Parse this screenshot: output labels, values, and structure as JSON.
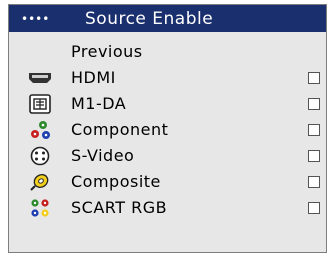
{
  "menu": {
    "title_dots": "••••",
    "title": "Source Enable",
    "previous": "Previous",
    "items": [
      {
        "label": "HDMI",
        "icon": "hdmi-icon",
        "checked": false
      },
      {
        "label": "M1-DA",
        "icon": "m1da-icon",
        "checked": false
      },
      {
        "label": "Component",
        "icon": "component-icon",
        "checked": false
      },
      {
        "label": "S-Video",
        "icon": "svideo-icon",
        "checked": false
      },
      {
        "label": "Composite",
        "icon": "composite-icon",
        "checked": false
      },
      {
        "label": "SCART RGB",
        "icon": "scart-icon",
        "checked": false
      }
    ]
  }
}
